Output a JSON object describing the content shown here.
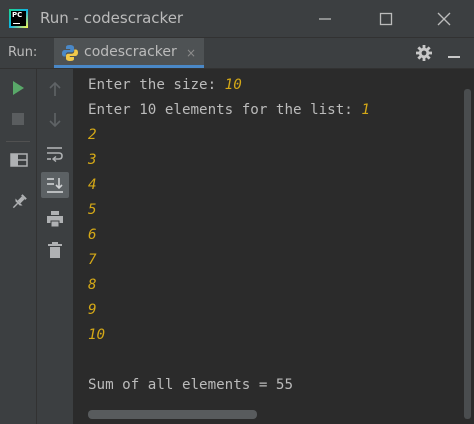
{
  "window": {
    "title": "Run - codescracker",
    "logo_text": "PC"
  },
  "run_panel": {
    "label": "Run:",
    "tab": {
      "label": "codescracker",
      "icon": "python-icon"
    },
    "close_glyph": "×"
  },
  "console": {
    "lines": [
      {
        "prompt": "Enter the size: ",
        "input": "10"
      },
      {
        "prompt": "Enter 10 elements for the list: ",
        "input": "1"
      },
      {
        "prompt": "",
        "input": "2"
      },
      {
        "prompt": "",
        "input": "3"
      },
      {
        "prompt": "",
        "input": "4"
      },
      {
        "prompt": "",
        "input": "5"
      },
      {
        "prompt": "",
        "input": "6"
      },
      {
        "prompt": "",
        "input": "7"
      },
      {
        "prompt": "",
        "input": "8"
      },
      {
        "prompt": "",
        "input": "9"
      },
      {
        "prompt": "",
        "input": "10"
      },
      {
        "prompt": "",
        "input": ""
      },
      {
        "prompt": "Sum of all elements = 55",
        "input": ""
      }
    ]
  },
  "colors": {
    "background": "#2b2b2b",
    "panel": "#3c3f41",
    "text": "#bbbbbb",
    "user_input": "#d4a817",
    "run_green": "#59a869",
    "tab_underline": "#4a88c7"
  }
}
